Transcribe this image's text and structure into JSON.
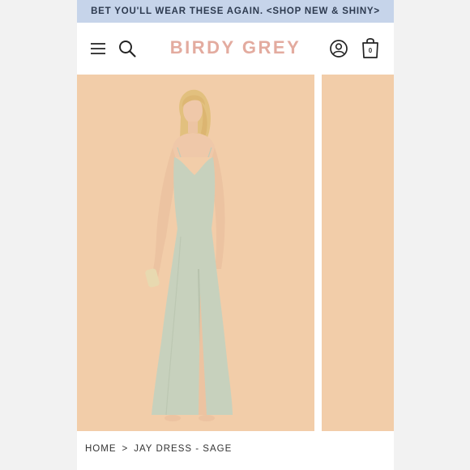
{
  "promo_banner": {
    "text": "BET YOU'LL WEAR THESE AGAIN. <SHOP NEW & SHINY>"
  },
  "header": {
    "brand": "BIRDY GREY",
    "menu_icon": "hamburger-menu-icon",
    "search_icon": "search-icon",
    "account_icon": "user-icon",
    "cart_icon": "shopping-bag-icon",
    "cart_count": "0"
  },
  "gallery": {
    "background_color": "#f2cda9",
    "dress_color": "#c7d1bd"
  },
  "breadcrumb": {
    "home": "HOME",
    "separator": ">",
    "current": "JAY DRESS - SAGE"
  },
  "colors": {
    "banner_bg": "#c6d4ea",
    "brand": "#e3ab9f"
  }
}
